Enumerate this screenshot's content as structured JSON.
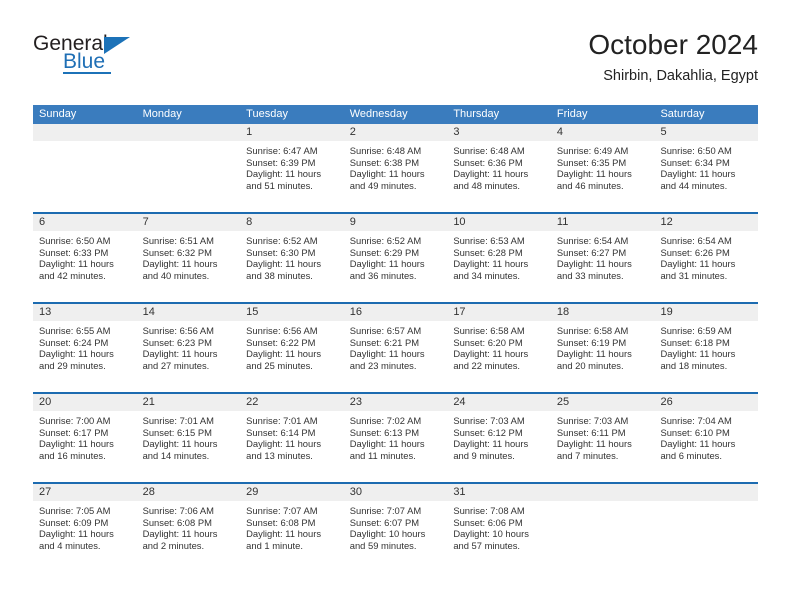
{
  "brand": {
    "name_part1": "General",
    "name_part2": "Blue"
  },
  "header": {
    "title": "October 2024",
    "subtitle": "Shirbin, Dakahlia, Egypt"
  },
  "calendar": {
    "weekdays": [
      "Sunday",
      "Monday",
      "Tuesday",
      "Wednesday",
      "Thursday",
      "Friday",
      "Saturday"
    ],
    "accent_color": "#3a7cbe",
    "rule_color": "#1c6bb0",
    "daynum_band_color": "#efefef",
    "weeks": [
      [
        {
          "day": "",
          "empty": true
        },
        {
          "day": "",
          "empty": true
        },
        {
          "day": "1",
          "sunrise": "Sunrise: 6:47 AM",
          "sunset": "Sunset: 6:39 PM",
          "daylight": "Daylight: 11 hours and 51 minutes."
        },
        {
          "day": "2",
          "sunrise": "Sunrise: 6:48 AM",
          "sunset": "Sunset: 6:38 PM",
          "daylight": "Daylight: 11 hours and 49 minutes."
        },
        {
          "day": "3",
          "sunrise": "Sunrise: 6:48 AM",
          "sunset": "Sunset: 6:36 PM",
          "daylight": "Daylight: 11 hours and 48 minutes."
        },
        {
          "day": "4",
          "sunrise": "Sunrise: 6:49 AM",
          "sunset": "Sunset: 6:35 PM",
          "daylight": "Daylight: 11 hours and 46 minutes."
        },
        {
          "day": "5",
          "sunrise": "Sunrise: 6:50 AM",
          "sunset": "Sunset: 6:34 PM",
          "daylight": "Daylight: 11 hours and 44 minutes."
        }
      ],
      [
        {
          "day": "6",
          "sunrise": "Sunrise: 6:50 AM",
          "sunset": "Sunset: 6:33 PM",
          "daylight": "Daylight: 11 hours and 42 minutes."
        },
        {
          "day": "7",
          "sunrise": "Sunrise: 6:51 AM",
          "sunset": "Sunset: 6:32 PM",
          "daylight": "Daylight: 11 hours and 40 minutes."
        },
        {
          "day": "8",
          "sunrise": "Sunrise: 6:52 AM",
          "sunset": "Sunset: 6:30 PM",
          "daylight": "Daylight: 11 hours and 38 minutes."
        },
        {
          "day": "9",
          "sunrise": "Sunrise: 6:52 AM",
          "sunset": "Sunset: 6:29 PM",
          "daylight": "Daylight: 11 hours and 36 minutes."
        },
        {
          "day": "10",
          "sunrise": "Sunrise: 6:53 AM",
          "sunset": "Sunset: 6:28 PM",
          "daylight": "Daylight: 11 hours and 34 minutes."
        },
        {
          "day": "11",
          "sunrise": "Sunrise: 6:54 AM",
          "sunset": "Sunset: 6:27 PM",
          "daylight": "Daylight: 11 hours and 33 minutes."
        },
        {
          "day": "12",
          "sunrise": "Sunrise: 6:54 AM",
          "sunset": "Sunset: 6:26 PM",
          "daylight": "Daylight: 11 hours and 31 minutes."
        }
      ],
      [
        {
          "day": "13",
          "sunrise": "Sunrise: 6:55 AM",
          "sunset": "Sunset: 6:24 PM",
          "daylight": "Daylight: 11 hours and 29 minutes."
        },
        {
          "day": "14",
          "sunrise": "Sunrise: 6:56 AM",
          "sunset": "Sunset: 6:23 PM",
          "daylight": "Daylight: 11 hours and 27 minutes."
        },
        {
          "day": "15",
          "sunrise": "Sunrise: 6:56 AM",
          "sunset": "Sunset: 6:22 PM",
          "daylight": "Daylight: 11 hours and 25 minutes."
        },
        {
          "day": "16",
          "sunrise": "Sunrise: 6:57 AM",
          "sunset": "Sunset: 6:21 PM",
          "daylight": "Daylight: 11 hours and 23 minutes."
        },
        {
          "day": "17",
          "sunrise": "Sunrise: 6:58 AM",
          "sunset": "Sunset: 6:20 PM",
          "daylight": "Daylight: 11 hours and 22 minutes."
        },
        {
          "day": "18",
          "sunrise": "Sunrise: 6:58 AM",
          "sunset": "Sunset: 6:19 PM",
          "daylight": "Daylight: 11 hours and 20 minutes."
        },
        {
          "day": "19",
          "sunrise": "Sunrise: 6:59 AM",
          "sunset": "Sunset: 6:18 PM",
          "daylight": "Daylight: 11 hours and 18 minutes."
        }
      ],
      [
        {
          "day": "20",
          "sunrise": "Sunrise: 7:00 AM",
          "sunset": "Sunset: 6:17 PM",
          "daylight": "Daylight: 11 hours and 16 minutes."
        },
        {
          "day": "21",
          "sunrise": "Sunrise: 7:01 AM",
          "sunset": "Sunset: 6:15 PM",
          "daylight": "Daylight: 11 hours and 14 minutes."
        },
        {
          "day": "22",
          "sunrise": "Sunrise: 7:01 AM",
          "sunset": "Sunset: 6:14 PM",
          "daylight": "Daylight: 11 hours and 13 minutes."
        },
        {
          "day": "23",
          "sunrise": "Sunrise: 7:02 AM",
          "sunset": "Sunset: 6:13 PM",
          "daylight": "Daylight: 11 hours and 11 minutes."
        },
        {
          "day": "24",
          "sunrise": "Sunrise: 7:03 AM",
          "sunset": "Sunset: 6:12 PM",
          "daylight": "Daylight: 11 hours and 9 minutes."
        },
        {
          "day": "25",
          "sunrise": "Sunrise: 7:03 AM",
          "sunset": "Sunset: 6:11 PM",
          "daylight": "Daylight: 11 hours and 7 minutes."
        },
        {
          "day": "26",
          "sunrise": "Sunrise: 7:04 AM",
          "sunset": "Sunset: 6:10 PM",
          "daylight": "Daylight: 11 hours and 6 minutes."
        }
      ],
      [
        {
          "day": "27",
          "sunrise": "Sunrise: 7:05 AM",
          "sunset": "Sunset: 6:09 PM",
          "daylight": "Daylight: 11 hours and 4 minutes."
        },
        {
          "day": "28",
          "sunrise": "Sunrise: 7:06 AM",
          "sunset": "Sunset: 6:08 PM",
          "daylight": "Daylight: 11 hours and 2 minutes."
        },
        {
          "day": "29",
          "sunrise": "Sunrise: 7:07 AM",
          "sunset": "Sunset: 6:08 PM",
          "daylight": "Daylight: 11 hours and 1 minute."
        },
        {
          "day": "30",
          "sunrise": "Sunrise: 7:07 AM",
          "sunset": "Sunset: 6:07 PM",
          "daylight": "Daylight: 10 hours and 59 minutes."
        },
        {
          "day": "31",
          "sunrise": "Sunrise: 7:08 AM",
          "sunset": "Sunset: 6:06 PM",
          "daylight": "Daylight: 10 hours and 57 minutes."
        },
        {
          "day": "",
          "empty": true
        },
        {
          "day": "",
          "empty": true
        }
      ]
    ]
  }
}
